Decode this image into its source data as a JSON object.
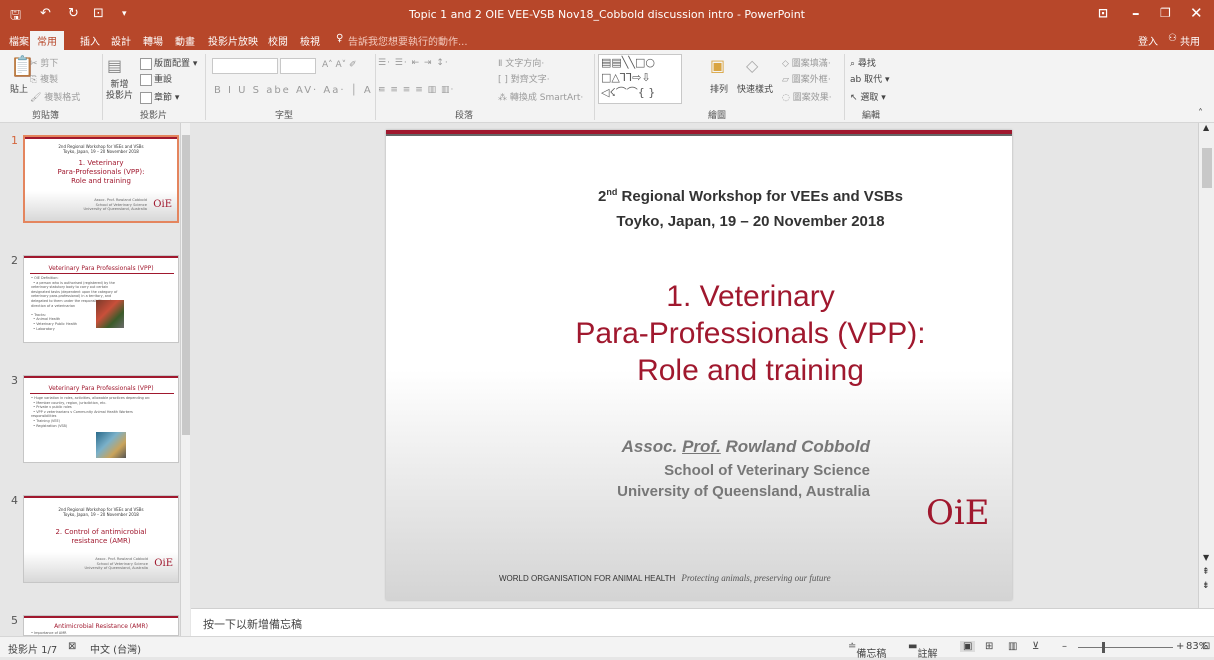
{
  "window": {
    "title": "Topic 1 and 2 OIE VEE-VSB Nov18_Cobbold discussion intro - PowerPoint",
    "quick_access": [
      "save-icon",
      "undo-icon",
      "redo-icon",
      "present-icon",
      "customize-icon"
    ]
  },
  "tabs": [
    "檔案",
    "常用",
    "插入",
    "設計",
    "轉場",
    "動畫",
    "投影片放映",
    "校閱",
    "檢視"
  ],
  "active_tab": "常用",
  "tell_me": "告訴我您想要執行的動作...",
  "account": {
    "signin": "登入",
    "share": "共用"
  },
  "ribbon": {
    "clipboard": {
      "paste": "貼上",
      "cut": "剪下",
      "copy": "複製",
      "format_painter": "複製格式",
      "label": "剪貼簿"
    },
    "slides": {
      "new_slide": "新增\n投影片",
      "layout": "版面配置",
      "reset": "重設",
      "section": "章節",
      "label": "投影片"
    },
    "font": {
      "label": "字型"
    },
    "paragraph": {
      "text_direction": "文字方向",
      "align_text": "對齊文字",
      "smartart": "轉換成 SmartArt",
      "label": "段落"
    },
    "drawing": {
      "arrange": "排列",
      "quick_styles": "快速樣式",
      "fill": "圖案填滿",
      "outline": "圖案外框",
      "effects": "圖案效果",
      "label": "繪圖"
    },
    "editing": {
      "find": "尋找",
      "replace": "取代",
      "select": "選取",
      "label": "編輯"
    }
  },
  "thumbnails": [
    {
      "num": "1",
      "line1": "2nd Regional Workshop for VEEs and VSBs",
      "line2": "Toyko, Japan, 19 – 20 November 2018",
      "title": "1. Veterinary\nPara-Professionals (VPP):\nRole and training",
      "author": "Assoc. Prof. Rowland Cobbold\nSchool of Veterinary Science\nUniversity of Queensland, Australia"
    },
    {
      "num": "2",
      "heading": "Veterinary Para Professionals (VPP)",
      "bullets": "• OIE Definition:\n  • a person who is authorised (registered) by the veterinary statutory body to carry out certain designated tasks (dependent upon the category of veterinary para-professional) in a territory, and delegated to them under the responsibility and direction of a veterinarian\n\n• Tracks:\n  • Animal Health\n  • Veterinary Public Health\n  • Laboratory"
    },
    {
      "num": "3",
      "heading": "Veterinary Para Professionals (VPP)",
      "bullets": "• Huge variation in roles, activities, allowable practices depending on:\n  • Member country, region, jurisdiction, etc.\n  • Private v public roles\n  • VPP v veterinarians v Community Animal Health Workers responsibilities\n  • Training (VEE)\n  • Registration (VSB)"
    },
    {
      "num": "4",
      "line1": "2nd Regional Workshop for VEEs and VSBs",
      "line2": "Toyko, Japan, 19 – 20 November 2018",
      "title": "2. Control of antimicrobial\nresistance (AMR)",
      "author": "Assoc. Prof. Rowland Cobbold\nSchool of Veterinary Science\nUniversity of Queensland, Australia"
    },
    {
      "num": "5",
      "heading": "Antimicrobial Resistance (AMR)",
      "bullets": "• Importance of AMR"
    }
  ],
  "slide": {
    "sub_pre": "2",
    "sub_sup": "nd",
    "sub_rest": " Regional Workshop for VEEs and VSBs",
    "sub2": "Toyko, Japan, 19 – 20 November 2018",
    "title_l1": "1. Veterinary",
    "title_l2": "Para-Professionals (VPP):",
    "title_l3": "Role and training",
    "author_pre": "Assoc. ",
    "author_prof": "Prof.",
    "author_name": " Rowland Cobbold",
    "school": "School of Veterinary Science",
    "university": "University of Queensland, Australia",
    "logo": "OiE",
    "footer_org": "WORLD ORGANISATION FOR ANIMAL HEALTH",
    "footer_motto": "Protecting animals, preserving our future"
  },
  "notes_placeholder": "按一下以新增備忘稿",
  "status": {
    "slide": "投影片 1/7",
    "language": "中文 (台灣)",
    "notes": "備忘稿",
    "comments": "註解",
    "zoom": "83%"
  },
  "colors": {
    "accent": "#b7472a",
    "slide_red": "#a0182e"
  }
}
